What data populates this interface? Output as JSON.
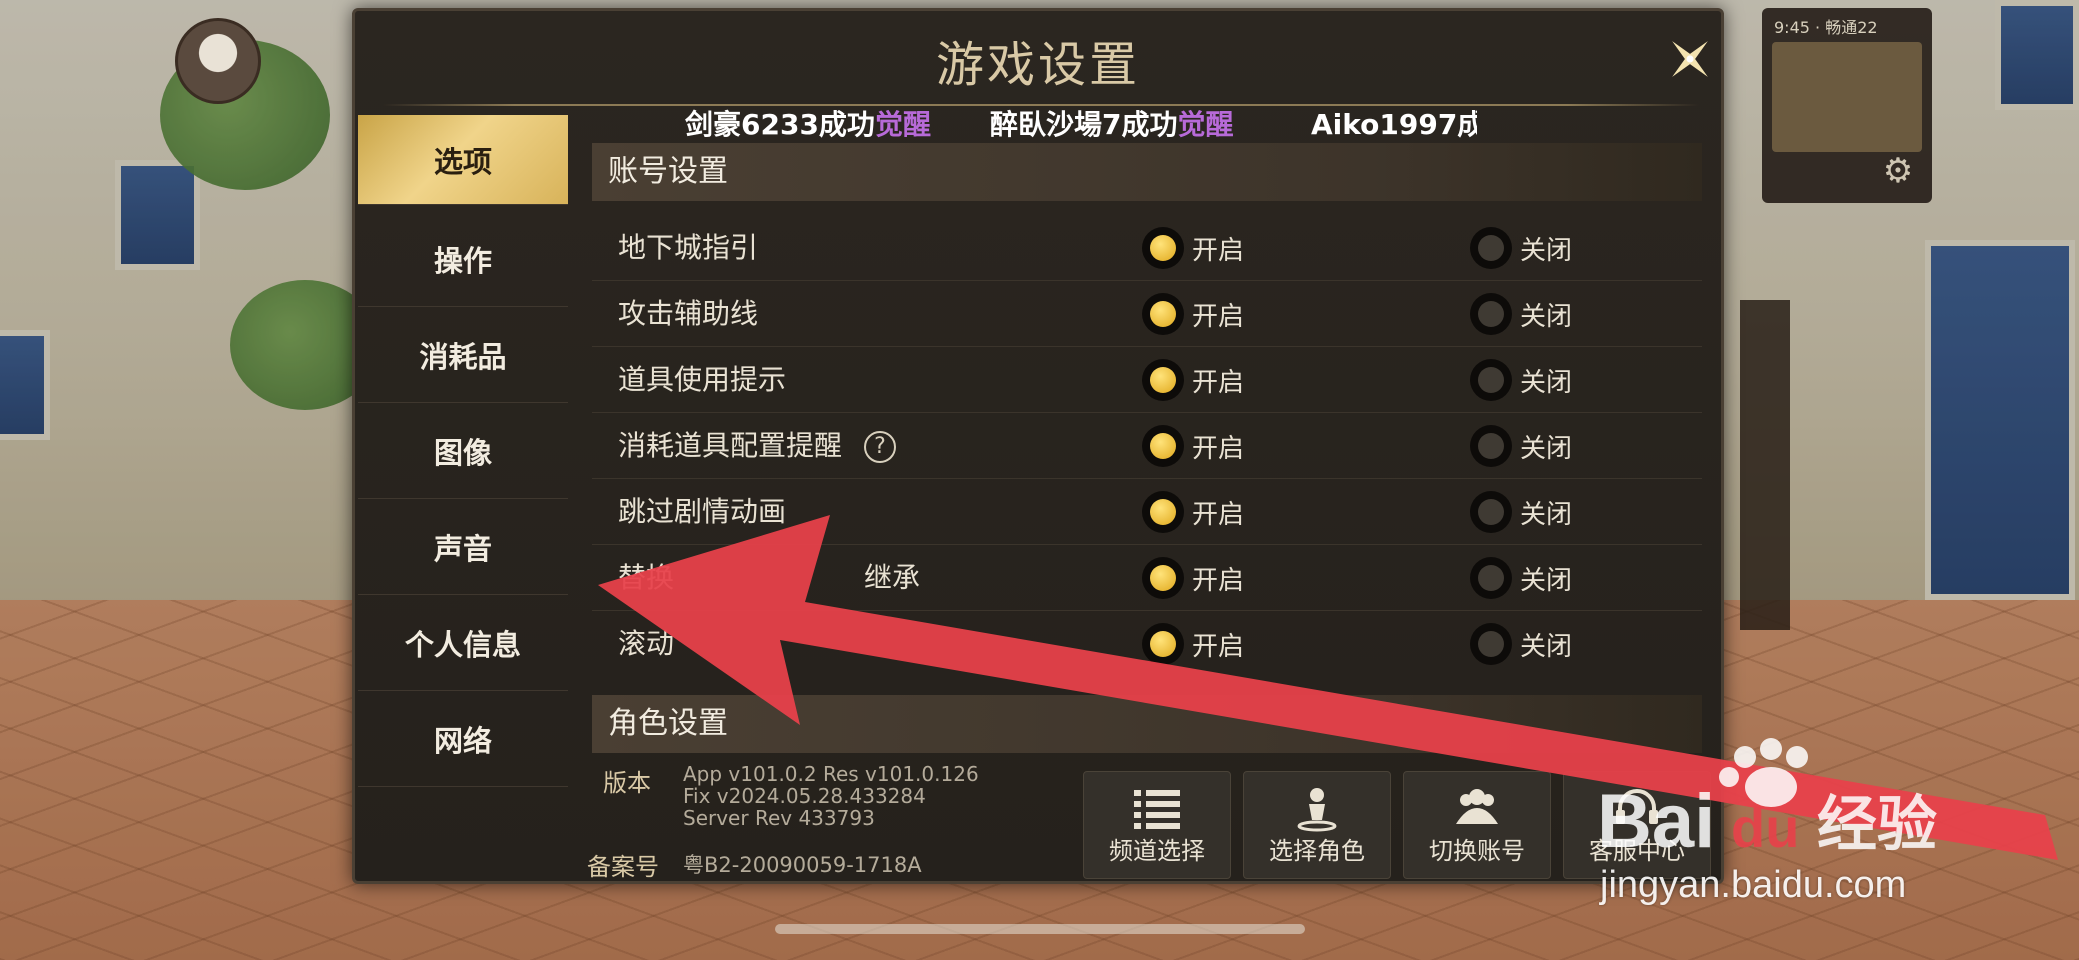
{
  "dialog": {
    "title": "游戏设置",
    "close_icon": "close-star-icon"
  },
  "ticker": [
    {
      "text": "剑豪6233成功",
      "highlight": "觉醒"
    },
    {
      "text": "醉臥沙場7成功",
      "highlight": "觉醒"
    },
    {
      "text": "Aiko1997成↑",
      "highlight": ""
    }
  ],
  "sidebar": {
    "items": [
      {
        "label": "选项",
        "active": true
      },
      {
        "label": "操作"
      },
      {
        "label": "消耗品"
      },
      {
        "label": "图像"
      },
      {
        "label": "声音"
      },
      {
        "label": "个人信息"
      },
      {
        "label": "网络"
      }
    ]
  },
  "account_section": {
    "title": "账号设置",
    "on_label": "开启",
    "off_label": "关闭",
    "rows": [
      {
        "label": "地下城指引",
        "value": "开启"
      },
      {
        "label": "攻击辅助线",
        "value": "开启"
      },
      {
        "label": "道具使用提示",
        "value": "开启"
      },
      {
        "label": "消耗道具配置提醒",
        "value": "开启",
        "help_icon": "?"
      },
      {
        "label": "跳过剧情动画",
        "value": "开启"
      },
      {
        "label": "替换",
        "label_suffix": "继承",
        "value": "开启"
      },
      {
        "label": "滚动",
        "value": "开启"
      }
    ]
  },
  "character_section": {
    "title": "角色设置"
  },
  "footer": {
    "version_label": "版本",
    "version_lines": [
      "App v101.0.2 Res v101.0.126",
      "Fix v2024.05.28.433284",
      "Server Rev 433793"
    ],
    "icp_label": "备案号",
    "icp_value": "粤B2-20090059-1718A",
    "buttons": [
      {
        "label": "频道选择",
        "icon": "list-icon"
      },
      {
        "label": "选择角色",
        "icon": "character-pin-icon"
      },
      {
        "label": "切换账号",
        "icon": "group-icon"
      },
      {
        "label": "客服中心",
        "icon": "headset-icon"
      }
    ]
  },
  "hud": {
    "status_text": "9:45 · 畅通22"
  },
  "watermark": {
    "brand": "Bai",
    "brand_suffix": "经验",
    "url": "jingyan.baidu.com"
  },
  "colors": {
    "accent_gold": "#f0d48a",
    "highlight_purple": "#b76ad8",
    "annotation_arrow": "#e8414a"
  }
}
